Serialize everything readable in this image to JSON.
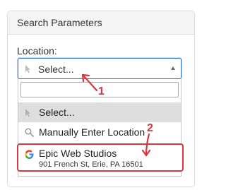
{
  "panel": {
    "header_title": "Search Parameters",
    "location_label": "Location:"
  },
  "select": {
    "selected_text": "Select..."
  },
  "dropdown": {
    "search_value": "",
    "options": [
      {
        "label": "Select...",
        "icon": "cursor-icon"
      },
      {
        "label": "Manually Enter Location",
        "icon": "search-icon"
      },
      {
        "label": "Epic Web Studios",
        "sublabel": "901 French St, Erie, PA 16501",
        "icon": "google-icon"
      }
    ]
  },
  "annotations": {
    "step_1": "1",
    "step_2": "2",
    "color": "#d9363e"
  }
}
